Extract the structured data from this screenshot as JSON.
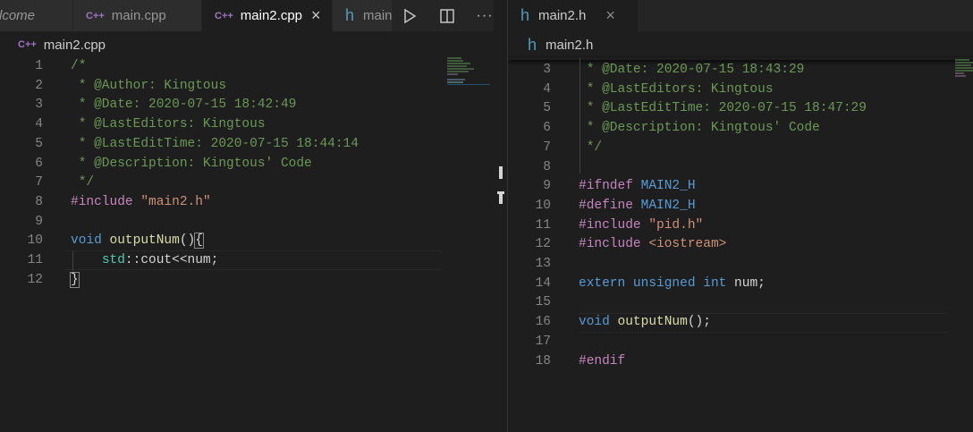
{
  "left": {
    "tabs": [
      {
        "label": "lcome",
        "icon": "none",
        "italic": true,
        "active": false
      },
      {
        "label": "main.cpp",
        "icon": "C++",
        "active": false
      },
      {
        "label": "main2.cpp",
        "icon": "C++",
        "active": true,
        "close": "×"
      },
      {
        "label": "main",
        "icon": "h",
        "active": false
      }
    ],
    "actions": [
      "run-icon",
      "split-editor-icon",
      "more-actions-icon"
    ],
    "more_label": "···",
    "breadcrumb": {
      "icon": "C++",
      "label": "main2.cpp"
    },
    "lines": [
      {
        "n": "1",
        "tokens": [
          {
            "t": "/*",
            "c": "comment"
          }
        ]
      },
      {
        "n": "2",
        "tokens": [
          {
            "t": " * @Author: Kingtous",
            "c": "comment"
          }
        ]
      },
      {
        "n": "3",
        "tokens": [
          {
            "t": " * @Date: 2020-07-15 18:42:49",
            "c": "comment"
          }
        ]
      },
      {
        "n": "4",
        "tokens": [
          {
            "t": " * @LastEditors: Kingtous",
            "c": "comment"
          }
        ]
      },
      {
        "n": "5",
        "tokens": [
          {
            "t": " * @LastEditTime: 2020-07-15 18:44:14",
            "c": "comment"
          }
        ]
      },
      {
        "n": "6",
        "tokens": [
          {
            "t": " * @Description: Kingtous' Code",
            "c": "comment"
          }
        ]
      },
      {
        "n": "7",
        "tokens": [
          {
            "t": " */",
            "c": "comment"
          }
        ]
      },
      {
        "n": "8",
        "tokens": [
          {
            "t": "#include ",
            "c": "pre"
          },
          {
            "t": "\"main2.h\"",
            "c": "str"
          }
        ]
      },
      {
        "n": "9",
        "tokens": []
      },
      {
        "n": "10",
        "tokens": [
          {
            "t": "void",
            "c": "kw"
          },
          {
            "t": " ",
            "c": "plain"
          },
          {
            "t": "outputNum",
            "c": "fn"
          },
          {
            "t": "()",
            "c": "plain"
          },
          {
            "t": "{",
            "c": "plain",
            "bracket": true
          }
        ]
      },
      {
        "n": "11",
        "tokens": [
          {
            "t": "    ",
            "c": "plain"
          },
          {
            "t": "std",
            "c": "ns"
          },
          {
            "t": "::cout<<num;",
            "c": "plain"
          }
        ]
      },
      {
        "n": "12",
        "tokens": [
          {
            "t": "}",
            "c": "plain",
            "bracket": true
          }
        ]
      }
    ]
  },
  "right": {
    "tabs": [
      {
        "label": "main2.h",
        "icon": "h",
        "active": true,
        "close": "×"
      }
    ],
    "breadcrumb": {
      "icon": "h",
      "label": "main2.h"
    },
    "lines": [
      {
        "n": "3",
        "tokens": [
          {
            "t": " * @Date: 2020-07-15 18:43:29",
            "c": "comment"
          }
        ]
      },
      {
        "n": "4",
        "tokens": [
          {
            "t": " * @LastEditors: Kingtous",
            "c": "comment"
          }
        ]
      },
      {
        "n": "5",
        "tokens": [
          {
            "t": " * @LastEditTime: 2020-07-15 18:47:29",
            "c": "comment"
          }
        ]
      },
      {
        "n": "6",
        "tokens": [
          {
            "t": " * @Description: Kingtous' Code",
            "c": "comment"
          }
        ]
      },
      {
        "n": "7",
        "tokens": [
          {
            "t": " */",
            "c": "comment"
          }
        ]
      },
      {
        "n": "8",
        "tokens": []
      },
      {
        "n": "9",
        "tokens": [
          {
            "t": "#ifndef ",
            "c": "pre"
          },
          {
            "t": "MAIN2_H",
            "c": "macro"
          }
        ]
      },
      {
        "n": "10",
        "tokens": [
          {
            "t": "#define ",
            "c": "pre"
          },
          {
            "t": "MAIN2_H",
            "c": "macro"
          }
        ]
      },
      {
        "n": "11",
        "tokens": [
          {
            "t": "#include ",
            "c": "pre"
          },
          {
            "t": "\"pid.h\"",
            "c": "str"
          }
        ]
      },
      {
        "n": "12",
        "tokens": [
          {
            "t": "#include ",
            "c": "pre"
          },
          {
            "t": "<iostream>",
            "c": "str"
          }
        ]
      },
      {
        "n": "13",
        "tokens": []
      },
      {
        "n": "14",
        "tokens": [
          {
            "t": "extern",
            "c": "kw"
          },
          {
            "t": " ",
            "c": "plain"
          },
          {
            "t": "unsigned",
            "c": "kw"
          },
          {
            "t": " ",
            "c": "plain"
          },
          {
            "t": "int",
            "c": "kw"
          },
          {
            "t": " num;",
            "c": "plain"
          }
        ]
      },
      {
        "n": "15",
        "tokens": []
      },
      {
        "n": "16",
        "tokens": [
          {
            "t": "void",
            "c": "kw"
          },
          {
            "t": " ",
            "c": "plain"
          },
          {
            "t": "outputNum",
            "c": "fn"
          },
          {
            "t": "();",
            "c": "plain"
          }
        ]
      },
      {
        "n": "17",
        "tokens": []
      },
      {
        "n": "18",
        "tokens": [
          {
            "t": "#endif",
            "c": "pre"
          }
        ]
      }
    ]
  }
}
